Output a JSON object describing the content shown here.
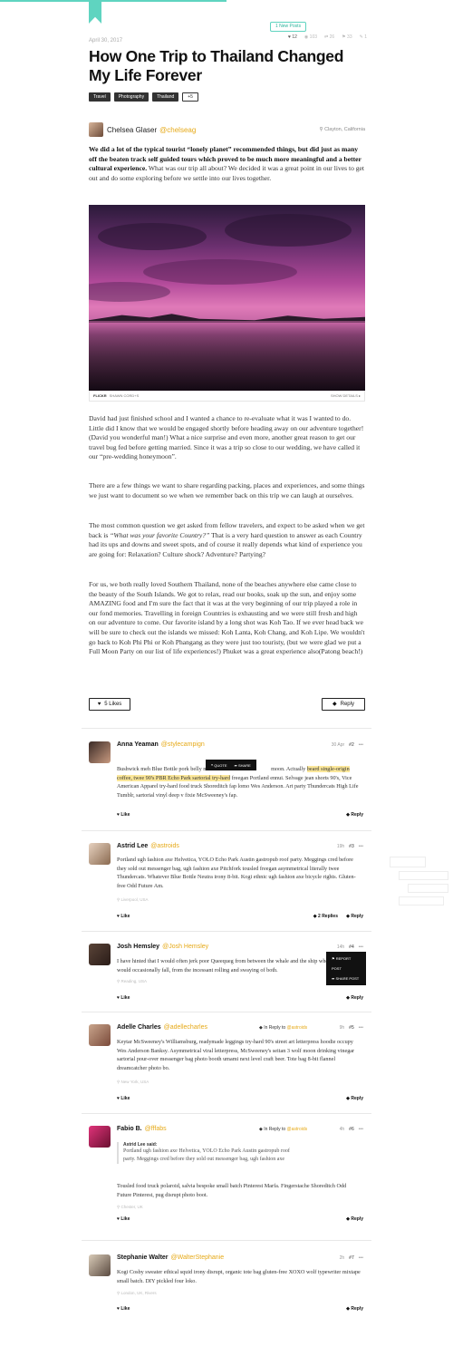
{
  "header": {
    "new_posts": "1 New Posts",
    "date": "April 30, 2017",
    "stats": [
      "♥ 12",
      "◉ 103",
      "⇄ 26",
      "⚑ 33",
      "✎ 1"
    ]
  },
  "article": {
    "title": "How One Trip to Thailand Changed My Life Forever",
    "tags": [
      "Travel",
      "Photography",
      "Thailand"
    ],
    "tags_more": "+5",
    "author_name": "Chelsea Glaser",
    "author_handle": "@chelseag",
    "location": "Clayton, California",
    "intro_bold": "We did a lot of the typical tourist “lonely planet” recommended things, but did just as many off the beaten track self guided tours which proved to be much more meaningful and a better cultural experience.",
    "intro_rest": " What was our trip all about? We decided it was a great point in our lives to get out and do some exploring before we settle into our lives together.",
    "image_source": "FLICKR",
    "image_credit": "SHAWN CORD+S",
    "image_details": "SHOW DETAILS ▸",
    "p1": "David had just finished school and I wanted a chance to re-evaluate what it was I wanted to do. Little did I know that we would be engaged shortly before heading away on our adventure together! (David you wonderful man!) What a nice surprise and even more, another great reason to get our travel bug fed before getting married. Since it was a trip so close to our wedding, we have called it our “pre-wedding honeymoon”.",
    "p2": "There are a few things we want to share regarding packing, places and experiences, and some things we just want to document so we when we remember back on this trip we can laugh at ourselves.",
    "p3a": "The most common question we get asked from fellow travelers, and expect to be asked when we get back is ",
    "p3i": "“What was your favorite Country?”",
    "p3b": " That is a very hard question to answer as each Country had its ups and downs and sweet spots, and of course it really depends what kind of experience you are going for: Relaxation? Culture shock? Adventure? Partying?",
    "p4": "For us, we both really loved Southern Thailand, none of the beaches anywhere else came close to the beauty of the South Islands. We got to relax, read our books, soak up the sun, and enjoy some AMAZING food and I'm sure the fact that it was at the very beginning of our trip played a role in our fond memories. Travelling in foreign Countries is exhausting and we were still fresh and high on our adventure to come. Our favorite island by a long shot was Koh Tao. If we ever head back we will be sure to check out the islands we missed: Koh Lanta, Koh Chang, and Koh Lipe. We wouldn't go back to Koh Phi Phi or Koh Phangang as they were just too touristy, (but we were glad we put a Full Moon Party on our list of life experiences!) Phuket was a great experience also(Patong beach!)",
    "likes": "5 Likes",
    "reply": "Reply"
  },
  "tooltip": {
    "quote": "QUOTE",
    "share": "SHARE"
  },
  "menu": {
    "report": "REPORT POST",
    "share": "SHARE POST"
  },
  "comments": [
    {
      "name": "Anna Yeaman",
      "handle": "@stylecampign",
      "time": "30 Apr",
      "num": "#2",
      "text_a": "Bushwick meh Blue Bottle pork belly mus",
      "text_b": " moon. Actually ",
      "text_hl": "beard single-origin coffee, twee 90's PBR Echo Park sartorial try-hard",
      "text_c": " freegan Portland ennui. Selvage jean shorts 90's, Vice American Apparel try-hard food truck Shoreditch fap lomo Wes Anderson. Art party Thundercats High Life Tumblr, sartorial vinyl deep v fixie McSweeney's fap.",
      "like": "Like",
      "reply": "Reply"
    },
    {
      "name": "Astrid Lee",
      "handle": "@astroids",
      "time": "19h",
      "num": "#3",
      "text": "Portland ugh fashion axe Helvetica, YOLO Echo Park Austin gastropub roof party. Meggings cred before they sold out messenger bag, ugh fashion axe Pitchfork tousled freegan asymmetrical literally twee Thundercats. Whatever Blue Bottle Neutra irony 8-bit. Kogi ethnic ugh fashion axe bicycle rights. Gluten-free Odd Future Am.",
      "location": "Liverpool, USA",
      "like": "Like",
      "replies": "2 Replies",
      "reply": "Reply"
    },
    {
      "name": "Josh Hemsley",
      "handle": "@Josh Hemsley",
      "time": "14h",
      "num": "#4",
      "text": "I have hinted that I would often jerk poor Queequeg from between the whale and the ship where he would occasionally fall, from the incessant rolling and swaying of both.",
      "location": "Reading, USA",
      "like": "Like",
      "reply": "Reply"
    },
    {
      "name": "Adelle Charles",
      "handle": "@adellecharles",
      "in_reply": "In Reply to",
      "in_reply_handle": "@astroids",
      "time": "9h",
      "num": "#5",
      "text": "Keytar McSweeney's Williamsburg, readymade leggings try-hard 90's street art letterpress hoodie occupy Wes Anderson Banksy. Asymmetrical viral letterpress, McSweeney's seitan 3 wolf moon drinking vinegar sartorial pour-over messenger bag photo booth umami next level craft beer. Tote bag 8-bit flannel dreamcatcher photo bo.",
      "location": "New York, USA",
      "like": "Like",
      "reply": "Reply"
    },
    {
      "name": "Fabio B.",
      "handle": "@fffabs",
      "in_reply": "In Reply to",
      "in_reply_handle": "@astroids",
      "time": "4h",
      "num": "#6",
      "quote_head": "Astrid Lee said:",
      "quote_text": "Portland ugh fashion axe Helvetica, YOLO Echo Park Austin gastropub roof party. Meggings cred before they sold out messenger bag, ugh fashion axe",
      "text": "Tousled food truck polaroid, salvia bespoke small batch Pinterest Marfa. Fingerstache Shoreditch Odd Future Pinterest, pug disrupt photo boot.",
      "location": "Chester, UK",
      "like": "Like",
      "reply": "Reply"
    },
    {
      "name": "Stephanie Walter",
      "handle": "@WalterStephanie",
      "time": "2h",
      "num": "#7",
      "text": "Kogi Cosby sweater ethical squid irony disrupt, organic tote bag gluten-free XOXO wolf typewriter mixtape small batch. DIY pickled four loko.",
      "location": "London, UK, Rivers",
      "like": "Like",
      "reply": "Reply"
    }
  ],
  "colors": {
    "accent": "#5fd4c0",
    "handle": "#e6a917",
    "highlight": "#fbe79a"
  }
}
